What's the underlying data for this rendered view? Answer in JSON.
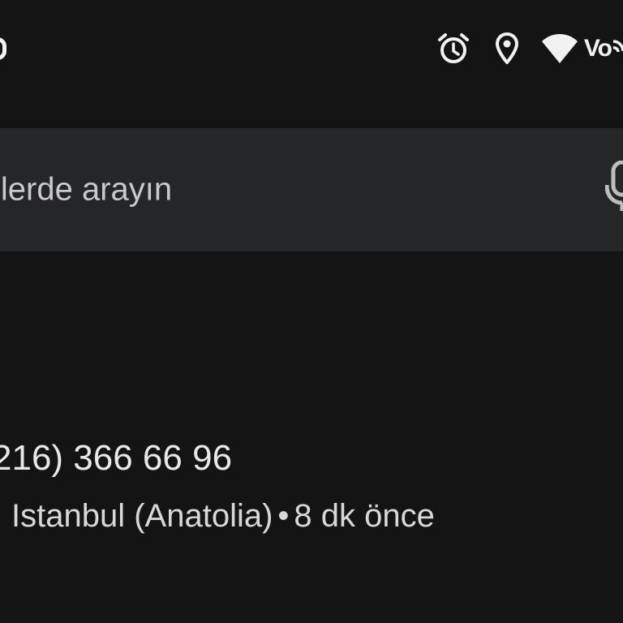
{
  "status_bar": {
    "icons": [
      "alarm-icon",
      "location-icon",
      "wifi-icon"
    ],
    "network_label": "Vo"
  },
  "search": {
    "placeholder_text": "ilerde arayın",
    "mic_icon": "mic-icon"
  },
  "result": {
    "phone_number": "216) 366 66 96",
    "location": "Istanbul (Anatolia)",
    "separator": "•",
    "time_ago": "8 dk önce"
  },
  "colors": {
    "background": "#141414",
    "search_bar": "#252628",
    "text_primary": "#e8e8e8",
    "text_secondary": "#c9c9c9",
    "icon": "#f2f2f2"
  }
}
